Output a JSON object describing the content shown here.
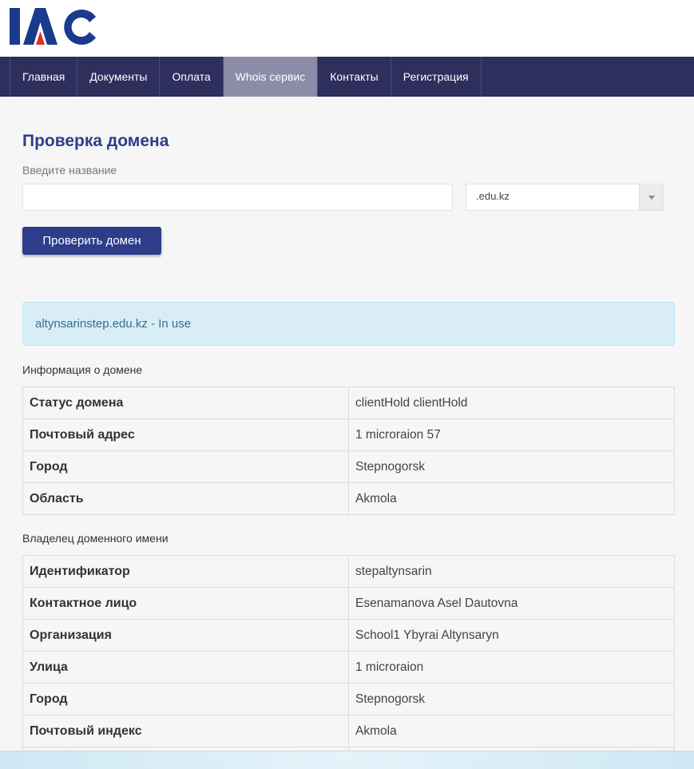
{
  "logo": {
    "text": "IAC",
    "colors": {
      "letters": "#1b3a8c",
      "triangle": "#e03030"
    }
  },
  "nav": {
    "items": [
      {
        "label": "Главная"
      },
      {
        "label": "Документы"
      },
      {
        "label": "Оплата"
      },
      {
        "label": "Whois сервис",
        "active": true
      },
      {
        "label": "Контакты"
      },
      {
        "label": "Регистрация"
      }
    ]
  },
  "search": {
    "title": "Проверка домена",
    "input_label": "Введите название",
    "input_value": "",
    "zone_selected": ".edu.kz",
    "button_label": "Проверить домен"
  },
  "result": {
    "alert_text": "altynsarinstep.edu.kz - In use"
  },
  "domain_info": {
    "caption": "Информация о домене",
    "rows": [
      {
        "key": "Статус домена",
        "value": "clientHold clientHold"
      },
      {
        "key": "Почтовый адрес",
        "value": "1 microraion 57"
      },
      {
        "key": "Город",
        "value": "Stepnogorsk"
      },
      {
        "key": "Область",
        "value": "Akmola"
      }
    ]
  },
  "owner": {
    "caption": "Владелец доменного имени",
    "rows": [
      {
        "key": "Идентификатор",
        "value": "stepaltynsarin"
      },
      {
        "key": "Контактное лицо",
        "value": "Esenamanova Asel Dautovna"
      },
      {
        "key": "Организация",
        "value": "School1 Ybyrai Altynsaryn"
      },
      {
        "key": "Улица",
        "value": "1 microraion"
      },
      {
        "key": "Город",
        "value": "Stepnogorsk"
      },
      {
        "key": "Почтовый индекс",
        "value": "Akmola"
      }
    ]
  },
  "colors": {
    "brand": "#2d3d8a",
    "nav_bg": "#2e2f5c",
    "nav_active": "#8b8da8",
    "alert_bg": "#d9edf7",
    "alert_text": "#31708f"
  }
}
